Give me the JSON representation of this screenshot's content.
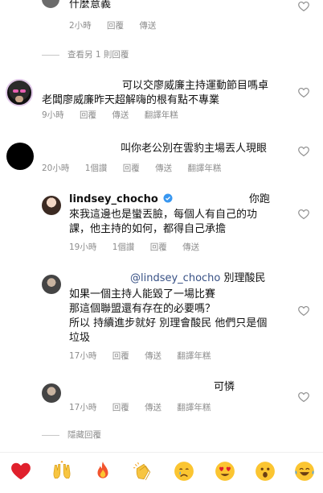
{
  "comments": [
    {
      "text_lines": [
        "什麼意義"
      ],
      "time": "2小時",
      "reply": "回覆",
      "send": "傳送"
    },
    {
      "view_replies": "查看另 1 則回覆"
    },
    {
      "text_lines": [
        "可以交廖威廉主持運動節目嗎卓",
        "老闆廖威廉昨天超解嗨的根有點不專業"
      ],
      "time": "9小時",
      "reply": "回覆",
      "send": "傳送",
      "translate": "翻譯年糕"
    },
    {
      "text_lines": [
        "叫你老公別在雲豹主場丟人現眼"
      ],
      "time": "20小時",
      "likes": "1個讚",
      "reply": "回覆",
      "send": "傳送",
      "translate": "翻譯年糕"
    },
    {
      "username": "lindsey_chocho",
      "text_lines": [
        "你跑",
        "來我這邊也是蠻丟臉，每個人有自己的功",
        "課，他主持的如何，都得自己承擔"
      ],
      "time": "19小時",
      "likes": "1個讚",
      "reply": "回覆",
      "send": "傳送"
    },
    {
      "mention": "@lindsey_chocho",
      "text_lines": [
        "別理酸民",
        "如果一個主持人能毀了一場比賽",
        "那這個聯盟還有存在的必要嗎？",
        "所以 持續進步就好 別理會酸民 他們只是個",
        "垃圾"
      ],
      "time": "17小時",
      "reply": "回覆",
      "send": "傳送",
      "translate": "翻譯年糕"
    },
    {
      "text_lines": [
        "可憐"
      ],
      "time": "17小時",
      "reply": "回覆",
      "send": "傳送",
      "translate": "翻譯年糕"
    },
    {
      "hide_replies": "隱藏回覆"
    }
  ],
  "reactions": [
    "red-heart-icon",
    "raising-hands-icon",
    "fire-icon",
    "clapping-hands-icon",
    "crying-face-icon",
    "heart-eyes-face-icon",
    "surprised-face-icon",
    "tears-of-joy-face-icon"
  ],
  "colors": {
    "meta": "#8e8e8e",
    "text": "#111111",
    "mention": "#385185"
  }
}
